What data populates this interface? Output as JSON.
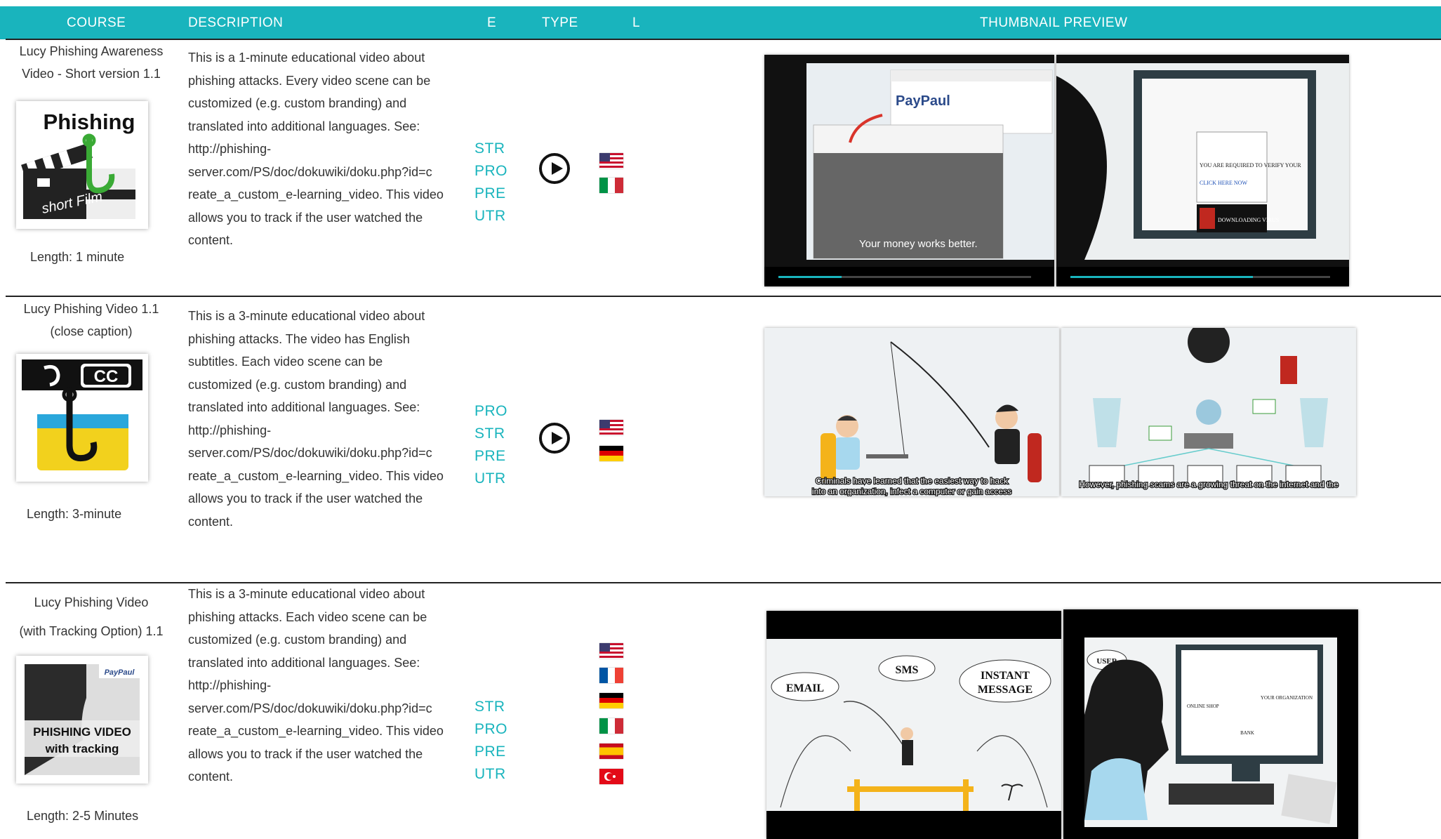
{
  "header": {
    "course": "COURSE",
    "description": "DESCRIPTION",
    "e": "E",
    "type": "TYPE",
    "l": "L",
    "thumbnail_preview": "THUMBNAIL PREVIEW"
  },
  "courses": [
    {
      "title_lines": [
        "Lucy Phishing Awareness",
        "Video - Short version 1.1"
      ],
      "thumb_text": [
        "Phishing",
        "short Film"
      ],
      "length": "Length: 1 minute",
      "description_lines": [
        "This is a 1-minute educational video about",
        "phishing attacks. Every video scene can be",
        "customized (e.g. custom branding) and",
        "translated into additional languages. See:",
        "http://phishing-",
        "server.com/PS/doc/dokuwiki/doku.php?id=c",
        "reate_a_custom_e-learning_video. This video",
        "allows you to track if the user watched the",
        "content."
      ],
      "types": [
        "STR",
        "PRO",
        "PRE",
        "UTR"
      ],
      "flags": [
        "us",
        "it"
      ],
      "preview1_text": [
        "PayPaul",
        "Your money works better."
      ],
      "preview2_text": [
        "YOU ARE REQUIRED TO VERIFY YOUR",
        "CLICK HERE NOW",
        "DOWNLOADING VIRUS"
      ]
    },
    {
      "title_lines": [
        "Lucy Phishing Video 1.1",
        "(close caption)"
      ],
      "thumb_text": [
        "CC"
      ],
      "length": "Length:  3-minute",
      "description_lines": [
        "This is a 3-minute educational video about",
        "phishing attacks. The video has English",
        "subtitles. Each video scene can be",
        "customized (e.g. custom branding) and",
        "translated into additional languages. See:",
        "http://phishing-",
        "server.com/PS/doc/dokuwiki/doku.php?id=c",
        "reate_a_custom_e-learning_video. This video",
        "allows you to track if the user watched the",
        "content."
      ],
      "types": [
        "PRO",
        "STR",
        "PRE",
        "UTR"
      ],
      "flags": [
        "us",
        "de"
      ],
      "preview1_text": [
        "Criminals have learned that the easiest way to hack",
        "into an organization, infect a computer or gain access"
      ],
      "preview2_text": [
        "However, phishing scams are a growing threat on the internet and the"
      ]
    },
    {
      "title_lines": [
        "Lucy Phishing Video",
        "(with Tracking Option) 1.1"
      ],
      "thumb_text": [
        "PayPaul",
        "PHISHING VIDEO",
        "with tracking"
      ],
      "length": "Length: 2-5 Minutes",
      "description_lines": [
        "This is a 3-minute educational video about",
        "phishing attacks. Each video scene can be",
        "customized (e.g. custom branding) and",
        "translated into additional languages. See:",
        "http://phishing-",
        "server.com/PS/doc/dokuwiki/doku.php?id=c",
        "reate_a_custom_e-learning_video. This video",
        "allows you to track if the user watched the",
        "content."
      ],
      "types": [
        "STR",
        "PRO",
        "PRE",
        "UTR"
      ],
      "flags": [
        "us",
        "fr",
        "de",
        "it",
        "es",
        "tr"
      ],
      "preview1_text": [
        "EMAIL",
        "SMS",
        "INSTANT",
        "MESSAGE"
      ],
      "preview2_text": [
        "USER",
        "ONLINE SHOP",
        "YOUR ORGANIZATION",
        "BANK"
      ]
    }
  ]
}
